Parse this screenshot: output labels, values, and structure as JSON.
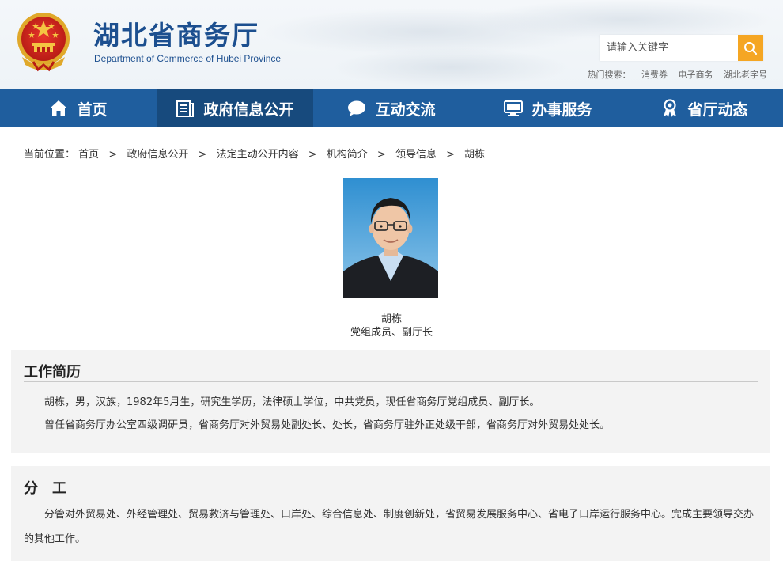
{
  "header": {
    "site_title": "湖北省商务厅",
    "site_subtitle": "Department of Commerce of Hubei Province",
    "search_placeholder": "请输入关键字",
    "hot_label": "热门搜索：",
    "hot_links": [
      "消费券",
      "电子商务",
      "湖北老字号"
    ]
  },
  "nav": {
    "items": [
      {
        "label": "首页",
        "icon": "home-icon"
      },
      {
        "label": "政府信息公开",
        "icon": "document-icon"
      },
      {
        "label": "互动交流",
        "icon": "chat-bubble-icon"
      },
      {
        "label": "办事服务",
        "icon": "monitor-icon"
      },
      {
        "label": "省厅动态",
        "icon": "award-icon"
      }
    ],
    "active_index": 1
  },
  "breadcrumb": {
    "label": "当前位置：",
    "items": [
      "首页",
      "政府信息公开",
      "法定主动公开内容",
      "机构简介",
      "领导信息",
      "胡栋"
    ],
    "separator": ">"
  },
  "profile": {
    "name": "胡栋",
    "title": "党组成员、副厅长"
  },
  "sections": {
    "resume": {
      "title": "工作简历",
      "paragraphs": [
        "胡栋，男，汉族，1982年5月生，研究生学历，法律硕士学位，中共党员，现任省商务厅党组成员、副厅长。",
        "曾任省商务厅办公室四级调研员，省商务厅对外贸易处副处长、处长，省商务厅驻外正处级干部，省商务厅对外贸易处处长。"
      ]
    },
    "duties": {
      "title": "分　工",
      "paragraphs": [
        "分管对外贸易处、外经管理处、贸易救济与管理处、口岸处、综合信息处、制度创新处，省贸易发展服务中心、省电子口岸运行服务中心。完成主要领导交办的其他工作。"
      ]
    }
  },
  "colors": {
    "brand_blue": "#1c4f8f",
    "nav_blue": "#1f5e9e",
    "nav_active": "#174a7d",
    "search_orange": "#f5a623"
  }
}
